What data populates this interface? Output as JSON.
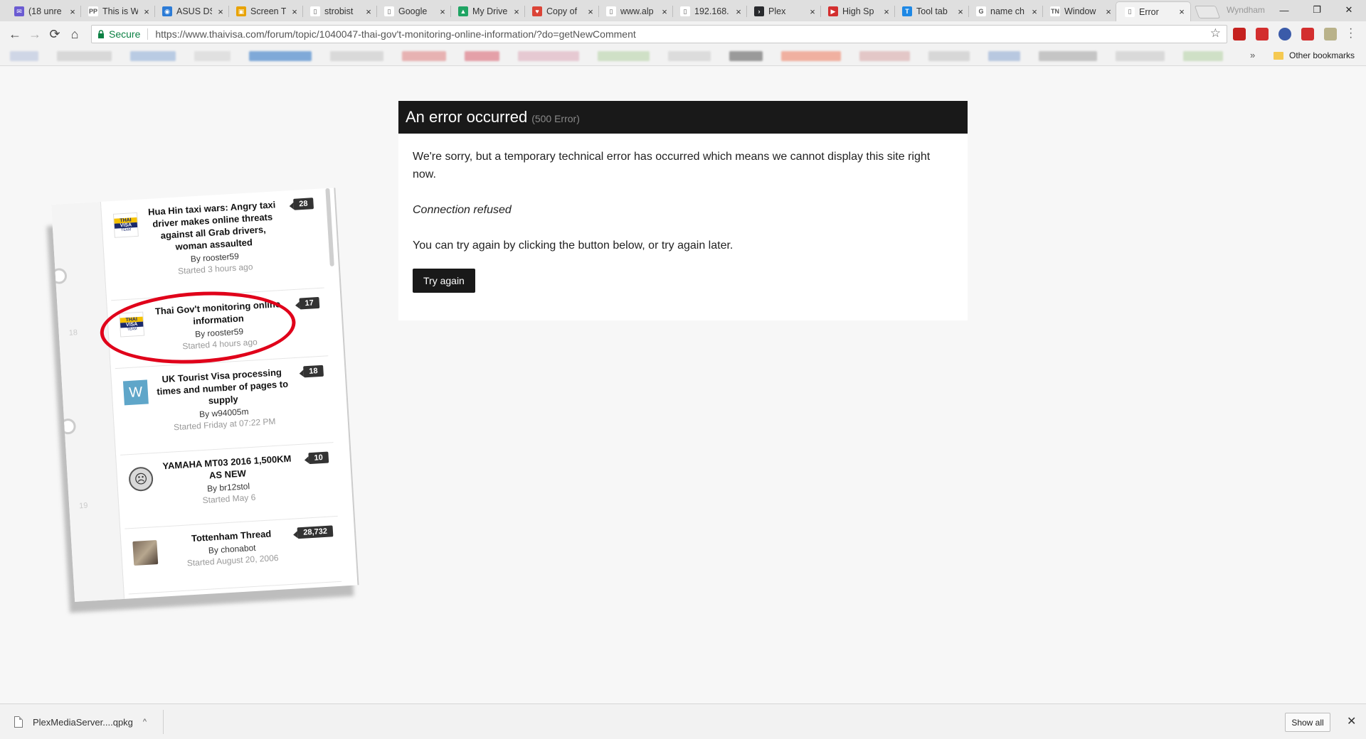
{
  "tabs": [
    {
      "label": "(18 unre",
      "fav_color": "#6b5bd2",
      "fav_glyph": "✉"
    },
    {
      "label": "This is W",
      "fav_color": "#ffffff",
      "fav_glyph": "PP"
    },
    {
      "label": "ASUS DS",
      "fav_color": "#2b7bd6",
      "fav_glyph": "◉"
    },
    {
      "label": "Screen T",
      "fav_color": "#e8a200",
      "fav_glyph": "▣"
    },
    {
      "label": "strobist",
      "fav_color": "#ffffff",
      "fav_glyph": "▯"
    },
    {
      "label": "Google",
      "fav_color": "#ffffff",
      "fav_glyph": "▯"
    },
    {
      "label": "My Drive",
      "fav_color": "#1fa463",
      "fav_glyph": "▲"
    },
    {
      "label": "Copy of",
      "fav_color": "#db4437",
      "fav_glyph": "♥"
    },
    {
      "label": "www.alp",
      "fav_color": "#ffffff",
      "fav_glyph": "▯"
    },
    {
      "label": "192.168.",
      "fav_color": "#ffffff",
      "fav_glyph": "▯"
    },
    {
      "label": "Plex",
      "fav_color": "#282a2d",
      "fav_glyph": "›"
    },
    {
      "label": "High Sp",
      "fav_color": "#d32f2f",
      "fav_glyph": "▶"
    },
    {
      "label": "Tool tab",
      "fav_color": "#1e88e5",
      "fav_glyph": "T"
    },
    {
      "label": "name ch",
      "fav_color": "#ffffff",
      "fav_glyph": "G"
    },
    {
      "label": "Window",
      "fav_color": "#ffffff",
      "fav_glyph": "TN"
    },
    {
      "label": "Error",
      "fav_color": "#ffffff",
      "fav_glyph": "▯",
      "active": true
    }
  ],
  "tab_close": "×",
  "profile_name": "Wyndham",
  "window_controls": {
    "minimize": "—",
    "restore": "❐",
    "close": "✕"
  },
  "nav": {
    "back": "←",
    "forward": "→",
    "reload": "⟳",
    "home": "⌂"
  },
  "address": {
    "secure_label": "Secure",
    "url": "https://www.thaivisa.com/forum/topic/1040047-thai-gov't-monitoring-online-information/?do=getNewComment",
    "star": "☆"
  },
  "extensions": [
    {
      "name": "gmail-checker-icon",
      "color": "#c5221f"
    },
    {
      "name": "ublock-icon",
      "color": "#d32f2f"
    },
    {
      "name": "globe-icon",
      "color": "#3b5ba9"
    },
    {
      "name": "lastpass-icon",
      "color": "#d32f2f"
    },
    {
      "name": "image-icon",
      "color": "#b9b28a"
    }
  ],
  "bookmarks": {
    "more": "»",
    "other": "Other bookmarks"
  },
  "error": {
    "title": "An error occurred",
    "code": "(500 Error)",
    "message": "We're sorry, but a temporary technical error has occurred which means we cannot display this site right now.",
    "detail": "Connection refused",
    "hint": "You can try again by clicking the button below, or try again later.",
    "button": "Try again"
  },
  "forum_shot": {
    "side_numbers": [
      "18",
      "19"
    ],
    "topics": [
      {
        "title": "Hua Hin taxi wars: Angry taxi driver makes online threats against all Grab drivers, woman assaulted",
        "by": "By rooster59",
        "started": "Started 3 hours ago",
        "count": "28",
        "avatar": "thai"
      },
      {
        "title": "Thai Gov't monitoring online information",
        "by": "By rooster59",
        "started": "Started 4 hours ago",
        "count": "17",
        "avatar": "thai"
      },
      {
        "title": "UK Tourist Visa processing times and number of pages to supply",
        "by": "By w94005m",
        "started": "Started Friday at 07:22 PM",
        "count": "18",
        "avatar": "w"
      },
      {
        "title": "YAMAHA MT03 2016 1,500KM AS NEW",
        "by": "By br12stol",
        "started": "Started May 6",
        "count": "10",
        "avatar": "face"
      },
      {
        "title": "Tottenham Thread",
        "by": "By chonabot",
        "started": "Started August 20, 2006",
        "count": "28,732",
        "avatar": "photo"
      }
    ],
    "thai_logo": {
      "l1": "THAI",
      "l2": "VISA",
      "l3": "TEAM"
    },
    "w_letter": "W",
    "face_glyph": "☹"
  },
  "download": {
    "filename": "PlexMediaServer....qpkg",
    "chevron": "^",
    "show_all": "Show all",
    "close": "✕"
  }
}
